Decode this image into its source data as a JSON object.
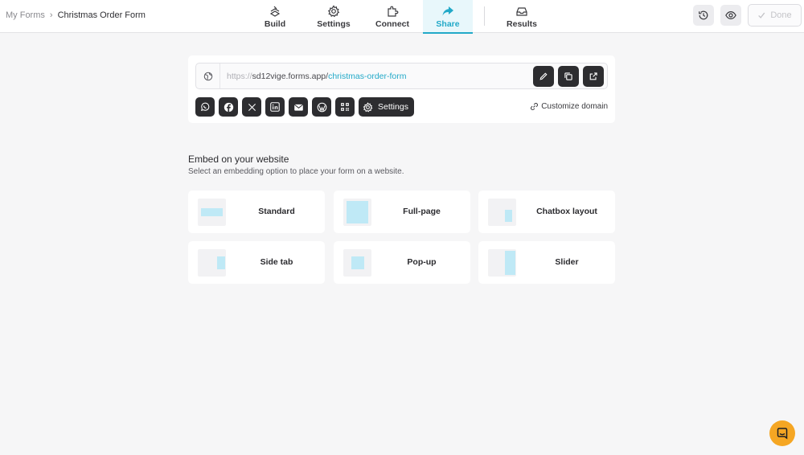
{
  "breadcrumb": {
    "root": "My Forms",
    "separator": "›",
    "current": "Christmas Order Form"
  },
  "nav": {
    "tabs": [
      {
        "label": "Build",
        "icon": "build-icon"
      },
      {
        "label": "Settings",
        "icon": "gear-icon"
      },
      {
        "label": "Connect",
        "icon": "puzzle-icon"
      },
      {
        "label": "Share",
        "icon": "share-icon",
        "active": true
      },
      {
        "label": "Results",
        "icon": "inbox-icon"
      }
    ]
  },
  "actions": {
    "done_label": "Done"
  },
  "share": {
    "url_protocol": "https://",
    "url_host": "sd12vige.forms.app/",
    "url_slug": "christmas-order-form",
    "settings_label": "Settings",
    "customize_label": "Customize domain",
    "social": [
      "whatsapp-icon",
      "facebook-icon",
      "x-icon",
      "linkedin-icon",
      "email-icon",
      "wordpress-icon",
      "qr-code-icon"
    ]
  },
  "embed": {
    "title": "Embed on your website",
    "subtitle": "Select an embedding option to place your form on a website.",
    "options": [
      {
        "label": "Standard"
      },
      {
        "label": "Full-page"
      },
      {
        "label": "Chatbox layout"
      },
      {
        "label": "Side tab"
      },
      {
        "label": "Pop-up"
      },
      {
        "label": "Slider"
      }
    ]
  },
  "colors": {
    "accent": "#22a9c8",
    "dark_button": "#2d2d30",
    "help_bubble": "#f5a623"
  }
}
